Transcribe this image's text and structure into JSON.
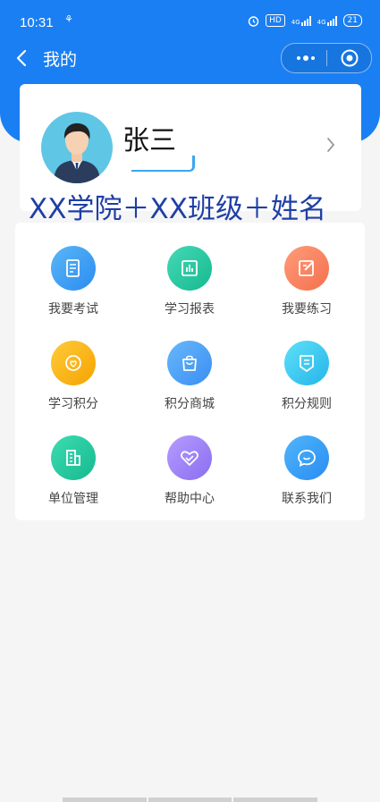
{
  "status_bar": {
    "time": "10:31",
    "hd": "HD",
    "net_1": "4G",
    "net_2": "4G",
    "battery": "21"
  },
  "nav": {
    "title": "我的"
  },
  "profile": {
    "name": "张三"
  },
  "overlay_text": "XX学院＋XX班级＋姓名",
  "menu": [
    {
      "label": "我要考试",
      "icon": "exam-icon",
      "color_from": "#5ab7f7",
      "color_to": "#2b8cf0"
    },
    {
      "label": "学习报表",
      "icon": "report-icon",
      "color_from": "#45d9b6",
      "color_to": "#16b98f"
    },
    {
      "label": "我要练习",
      "icon": "practice-icon",
      "color_from": "#ff9c78",
      "color_to": "#f4704f"
    },
    {
      "label": "学习积分",
      "icon": "points-icon",
      "color_from": "#ffcb3a",
      "color_to": "#f5a300"
    },
    {
      "label": "积分商城",
      "icon": "shop-icon",
      "color_from": "#67b8fb",
      "color_to": "#3b8ef3"
    },
    {
      "label": "积分规则",
      "icon": "rules-icon",
      "color_from": "#5fe0f7",
      "color_to": "#24b5ea"
    },
    {
      "label": "单位管理",
      "icon": "building-icon",
      "color_from": "#3ddcb2",
      "color_to": "#17b98e"
    },
    {
      "label": "帮助中心",
      "icon": "heart-help-icon",
      "color_from": "#b59cff",
      "color_to": "#8a6ef0"
    },
    {
      "label": "联系我们",
      "icon": "chat-icon",
      "color_from": "#4fb6fb",
      "color_to": "#2a8cf2"
    }
  ],
  "colors": {
    "primary": "#1a7ff3",
    "overlay_text": "#1f3fa6"
  }
}
